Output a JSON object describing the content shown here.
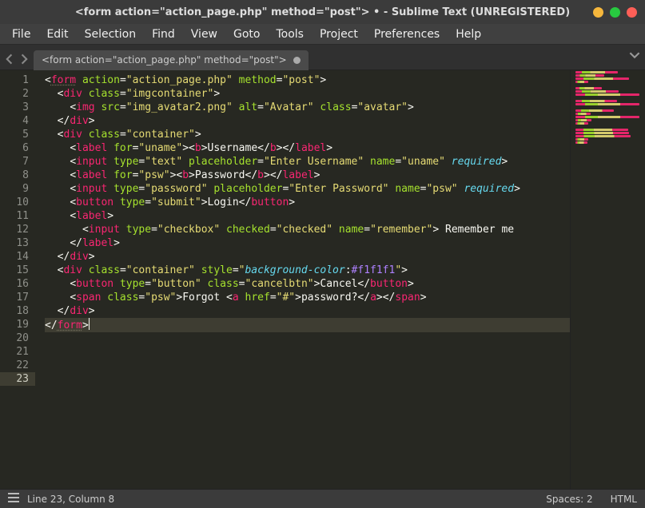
{
  "window": {
    "title": "<form action=\"action_page.php\" method=\"post\"> • - Sublime Text (UNREGISTERED)"
  },
  "menubar": {
    "items": [
      "File",
      "Edit",
      "Selection",
      "Find",
      "View",
      "Goto",
      "Tools",
      "Project",
      "Preferences",
      "Help"
    ]
  },
  "tab": {
    "label": "<form action=\"action_page.php\" method=\"post\">"
  },
  "code": {
    "lines": [
      {
        "n": "1",
        "t": [
          [
            "c-punc",
            "<"
          ],
          [
            "c-tag",
            "form"
          ],
          [
            "c-text",
            " "
          ],
          [
            "c-attr",
            "action"
          ],
          [
            "c-punc",
            "="
          ],
          [
            "c-str",
            "\"action_page.php\""
          ],
          [
            "c-text",
            " "
          ],
          [
            "c-attr",
            "method"
          ],
          [
            "c-punc",
            "="
          ],
          [
            "c-str",
            "\"post\""
          ],
          [
            "c-punc",
            ">"
          ]
        ]
      },
      {
        "n": "2",
        "t": [
          [
            "c-text",
            "  "
          ],
          [
            "c-punc",
            "<"
          ],
          [
            "c-tag",
            "div"
          ],
          [
            "c-text",
            " "
          ],
          [
            "c-attr",
            "class"
          ],
          [
            "c-punc",
            "="
          ],
          [
            "c-str",
            "\"imgcontainer\""
          ],
          [
            "c-punc",
            ">"
          ]
        ]
      },
      {
        "n": "3",
        "t": [
          [
            "c-text",
            "    "
          ],
          [
            "c-punc",
            "<"
          ],
          [
            "c-tag",
            "img"
          ],
          [
            "c-text",
            " "
          ],
          [
            "c-attr",
            "src"
          ],
          [
            "c-punc",
            "="
          ],
          [
            "c-str",
            "\"img_avatar2.png\""
          ],
          [
            "c-text",
            " "
          ],
          [
            "c-attr",
            "alt"
          ],
          [
            "c-punc",
            "="
          ],
          [
            "c-str",
            "\"Avatar\""
          ],
          [
            "c-text",
            " "
          ],
          [
            "c-attr",
            "class"
          ],
          [
            "c-punc",
            "="
          ],
          [
            "c-str",
            "\"avatar\""
          ],
          [
            "c-punc",
            ">"
          ]
        ]
      },
      {
        "n": "4",
        "t": [
          [
            "c-text",
            "  "
          ],
          [
            "c-punc",
            "</"
          ],
          [
            "c-tag",
            "div"
          ],
          [
            "c-punc",
            ">"
          ]
        ]
      },
      {
        "n": "5",
        "t": []
      },
      {
        "n": "6",
        "t": [
          [
            "c-text",
            "  "
          ],
          [
            "c-punc",
            "<"
          ],
          [
            "c-tag",
            "div"
          ],
          [
            "c-text",
            " "
          ],
          [
            "c-attr",
            "class"
          ],
          [
            "c-punc",
            "="
          ],
          [
            "c-str",
            "\"container\""
          ],
          [
            "c-punc",
            ">"
          ]
        ]
      },
      {
        "n": "7",
        "t": [
          [
            "c-text",
            "    "
          ],
          [
            "c-punc",
            "<"
          ],
          [
            "c-tag",
            "label"
          ],
          [
            "c-text",
            " "
          ],
          [
            "c-attr",
            "for"
          ],
          [
            "c-punc",
            "="
          ],
          [
            "c-str",
            "\"uname\""
          ],
          [
            "c-punc",
            ">"
          ],
          [
            "c-punc",
            "<"
          ],
          [
            "c-tag",
            "b"
          ],
          [
            "c-punc",
            ">"
          ],
          [
            "c-text",
            "Username"
          ],
          [
            "c-punc",
            "</"
          ],
          [
            "c-tag",
            "b"
          ],
          [
            "c-punc",
            ">"
          ],
          [
            "c-punc",
            "</"
          ],
          [
            "c-tag",
            "label"
          ],
          [
            "c-punc",
            ">"
          ]
        ]
      },
      {
        "n": "8",
        "t": [
          [
            "c-text",
            "    "
          ],
          [
            "c-punc",
            "<"
          ],
          [
            "c-tag",
            "input"
          ],
          [
            "c-text",
            " "
          ],
          [
            "c-attr",
            "type"
          ],
          [
            "c-punc",
            "="
          ],
          [
            "c-str",
            "\"text\""
          ],
          [
            "c-text",
            " "
          ],
          [
            "c-attr",
            "placeholder"
          ],
          [
            "c-punc",
            "="
          ],
          [
            "c-str",
            "\"Enter Username\""
          ],
          [
            "c-text",
            " "
          ],
          [
            "c-attr",
            "name"
          ],
          [
            "c-punc",
            "="
          ],
          [
            "c-str",
            "\"uname\""
          ],
          [
            "c-text",
            " "
          ],
          [
            "c-storage",
            "required"
          ],
          [
            "c-punc",
            ">"
          ]
        ]
      },
      {
        "n": "9",
        "t": []
      },
      {
        "n": "10",
        "t": [
          [
            "c-text",
            "    "
          ],
          [
            "c-punc",
            "<"
          ],
          [
            "c-tag",
            "label"
          ],
          [
            "c-text",
            " "
          ],
          [
            "c-attr",
            "for"
          ],
          [
            "c-punc",
            "="
          ],
          [
            "c-str",
            "\"psw\""
          ],
          [
            "c-punc",
            ">"
          ],
          [
            "c-punc",
            "<"
          ],
          [
            "c-tag",
            "b"
          ],
          [
            "c-punc",
            ">"
          ],
          [
            "c-text",
            "Password"
          ],
          [
            "c-punc",
            "</"
          ],
          [
            "c-tag",
            "b"
          ],
          [
            "c-punc",
            ">"
          ],
          [
            "c-punc",
            "</"
          ],
          [
            "c-tag",
            "label"
          ],
          [
            "c-punc",
            ">"
          ]
        ]
      },
      {
        "n": "11",
        "t": [
          [
            "c-text",
            "    "
          ],
          [
            "c-punc",
            "<"
          ],
          [
            "c-tag",
            "input"
          ],
          [
            "c-text",
            " "
          ],
          [
            "c-attr",
            "type"
          ],
          [
            "c-punc",
            "="
          ],
          [
            "c-str",
            "\"password\""
          ],
          [
            "c-text",
            " "
          ],
          [
            "c-attr",
            "placeholder"
          ],
          [
            "c-punc",
            "="
          ],
          [
            "c-str",
            "\"Enter Password\""
          ],
          [
            "c-text",
            " "
          ],
          [
            "c-attr",
            "name"
          ],
          [
            "c-punc",
            "="
          ],
          [
            "c-str",
            "\"psw\""
          ],
          [
            "c-text",
            " "
          ],
          [
            "c-storage",
            "required"
          ],
          [
            "c-punc",
            ">"
          ]
        ]
      },
      {
        "n": "12",
        "t": []
      },
      {
        "n": "13",
        "t": [
          [
            "c-text",
            "    "
          ],
          [
            "c-punc",
            "<"
          ],
          [
            "c-tag",
            "button"
          ],
          [
            "c-text",
            " "
          ],
          [
            "c-attr",
            "type"
          ],
          [
            "c-punc",
            "="
          ],
          [
            "c-str",
            "\"submit\""
          ],
          [
            "c-punc",
            ">"
          ],
          [
            "c-text",
            "Login"
          ],
          [
            "c-punc",
            "</"
          ],
          [
            "c-tag",
            "button"
          ],
          [
            "c-punc",
            ">"
          ]
        ]
      },
      {
        "n": "14",
        "t": [
          [
            "c-text",
            "    "
          ],
          [
            "c-punc",
            "<"
          ],
          [
            "c-tag",
            "label"
          ],
          [
            "c-punc",
            ">"
          ]
        ]
      },
      {
        "n": "15",
        "t": [
          [
            "c-text",
            "      "
          ],
          [
            "c-punc",
            "<"
          ],
          [
            "c-tag",
            "input"
          ],
          [
            "c-text",
            " "
          ],
          [
            "c-attr",
            "type"
          ],
          [
            "c-punc",
            "="
          ],
          [
            "c-str",
            "\"checkbox\""
          ],
          [
            "c-text",
            " "
          ],
          [
            "c-attr",
            "checked"
          ],
          [
            "c-punc",
            "="
          ],
          [
            "c-str",
            "\"checked\""
          ],
          [
            "c-text",
            " "
          ],
          [
            "c-attr",
            "name"
          ],
          [
            "c-punc",
            "="
          ],
          [
            "c-str",
            "\"remember\""
          ],
          [
            "c-punc",
            ">"
          ],
          [
            "c-text",
            " Remember me"
          ]
        ]
      },
      {
        "n": "16",
        "t": [
          [
            "c-text",
            "    "
          ],
          [
            "c-punc",
            "</"
          ],
          [
            "c-tag",
            "label"
          ],
          [
            "c-punc",
            ">"
          ]
        ]
      },
      {
        "n": "17",
        "t": [
          [
            "c-text",
            "  "
          ],
          [
            "c-punc",
            "</"
          ],
          [
            "c-tag",
            "div"
          ],
          [
            "c-punc",
            ">"
          ]
        ]
      },
      {
        "n": "18",
        "t": []
      },
      {
        "n": "19",
        "t": [
          [
            "c-text",
            "  "
          ],
          [
            "c-punc",
            "<"
          ],
          [
            "c-tag",
            "div"
          ],
          [
            "c-text",
            " "
          ],
          [
            "c-attr",
            "class"
          ],
          [
            "c-punc",
            "="
          ],
          [
            "c-str",
            "\"container\""
          ],
          [
            "c-text",
            " "
          ],
          [
            "c-attr",
            "style"
          ],
          [
            "c-punc",
            "="
          ],
          [
            "c-str",
            "\""
          ],
          [
            "c-css-prop",
            "background-color"
          ],
          [
            "c-punc",
            ":"
          ],
          [
            "c-const",
            "#f1f1f1"
          ],
          [
            "c-str",
            "\""
          ],
          [
            "c-punc",
            ">"
          ]
        ]
      },
      {
        "n": "20",
        "t": [
          [
            "c-text",
            "    "
          ],
          [
            "c-punc",
            "<"
          ],
          [
            "c-tag",
            "button"
          ],
          [
            "c-text",
            " "
          ],
          [
            "c-attr",
            "type"
          ],
          [
            "c-punc",
            "="
          ],
          [
            "c-str",
            "\"button\""
          ],
          [
            "c-text",
            " "
          ],
          [
            "c-attr",
            "class"
          ],
          [
            "c-punc",
            "="
          ],
          [
            "c-str",
            "\"cancelbtn\""
          ],
          [
            "c-punc",
            ">"
          ],
          [
            "c-text",
            "Cancel"
          ],
          [
            "c-punc",
            "</"
          ],
          [
            "c-tag",
            "button"
          ],
          [
            "c-punc",
            ">"
          ]
        ]
      },
      {
        "n": "21",
        "t": [
          [
            "c-text",
            "    "
          ],
          [
            "c-punc",
            "<"
          ],
          [
            "c-tag",
            "span"
          ],
          [
            "c-text",
            " "
          ],
          [
            "c-attr",
            "class"
          ],
          [
            "c-punc",
            "="
          ],
          [
            "c-str",
            "\"psw\""
          ],
          [
            "c-punc",
            ">"
          ],
          [
            "c-text",
            "Forgot "
          ],
          [
            "c-punc",
            "<"
          ],
          [
            "c-tag",
            "a"
          ],
          [
            "c-text",
            " "
          ],
          [
            "c-attr",
            "href"
          ],
          [
            "c-punc",
            "="
          ],
          [
            "c-str",
            "\"#\""
          ],
          [
            "c-punc",
            ">"
          ],
          [
            "c-text",
            "password?"
          ],
          [
            "c-punc",
            "</"
          ],
          [
            "c-tag",
            "a"
          ],
          [
            "c-punc",
            ">"
          ],
          [
            "c-punc",
            "</"
          ],
          [
            "c-tag",
            "span"
          ],
          [
            "c-punc",
            ">"
          ]
        ]
      },
      {
        "n": "22",
        "t": [
          [
            "c-text",
            "  "
          ],
          [
            "c-punc",
            "</"
          ],
          [
            "c-tag",
            "div"
          ],
          [
            "c-punc",
            ">"
          ]
        ]
      },
      {
        "n": "23",
        "t": [
          [
            "c-punc",
            "</"
          ],
          [
            "c-tag",
            "form"
          ],
          [
            "c-punc",
            ">"
          ]
        ],
        "active": true,
        "cursor": true
      }
    ]
  },
  "statusbar": {
    "position": "Line 23, Column 8",
    "spaces": "Spaces: 2",
    "syntax": "HTML"
  },
  "traffic_colors": {
    "min": "#f6b73c",
    "max": "#28c940",
    "close": "#ff5f57"
  },
  "minimap_palette": [
    "#f92672",
    "#a6e22e",
    "#e6db74",
    "#66d9ef",
    "#ae81ff",
    "#f8f8f2"
  ]
}
